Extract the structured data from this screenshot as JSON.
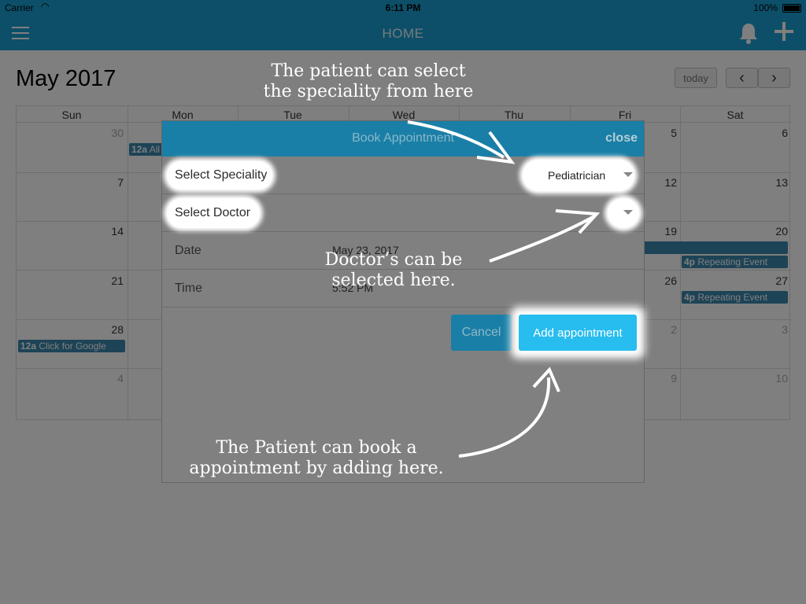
{
  "status_bar": {
    "carrier": "Carrier",
    "time": "6:11 PM",
    "battery": "100%"
  },
  "nav": {
    "title": "HOME"
  },
  "calendar": {
    "month_title": "May 2017",
    "today_label": "today",
    "prev_label": "‹",
    "next_label": "›",
    "weekdays": [
      "Sun",
      "Mon",
      "Tue",
      "Wed",
      "Thu",
      "Fri",
      "Sat"
    ],
    "day_numbers": {
      "r1": [
        "30",
        "5",
        "6"
      ],
      "r2": [
        "7",
        "12",
        "13"
      ],
      "r3": [
        "14",
        "19",
        "20"
      ],
      "r4": [
        "21",
        "26",
        "27"
      ],
      "r5": [
        "28",
        "2",
        "3"
      ],
      "r6": [
        "4",
        "9",
        "10"
      ]
    },
    "events": [
      {
        "time": "12a",
        "title": "All"
      },
      {
        "time": "4p",
        "title": "Repeating Event"
      },
      {
        "time": "4p",
        "title": "Repeating Event"
      },
      {
        "time": "12a",
        "title": "Click for Google"
      }
    ]
  },
  "modal": {
    "title": "Book Appointment",
    "close_label": "close",
    "speciality_label": "Select Speciality",
    "speciality_value": "Pediatrician",
    "doctor_label": "Select Doctor",
    "date_label": "Date",
    "date_value": "May 23, 2017",
    "time_label": "Time",
    "time_value": "5:52 PM",
    "cancel_label": "Cancel",
    "add_label": "Add appointment"
  },
  "annotations": {
    "speciality_note_1": "The patient can select",
    "speciality_note_2": "the speciality from here",
    "doctor_note_1": "Doctor’s can be",
    "doctor_note_2": "selected here.",
    "book_note_1": "The Patient can book a",
    "book_note_2": "appointment by adding here."
  },
  "colors": {
    "nav": "#1a9fd1",
    "event": "#3a87ad",
    "primary_button": "#27bdef"
  }
}
